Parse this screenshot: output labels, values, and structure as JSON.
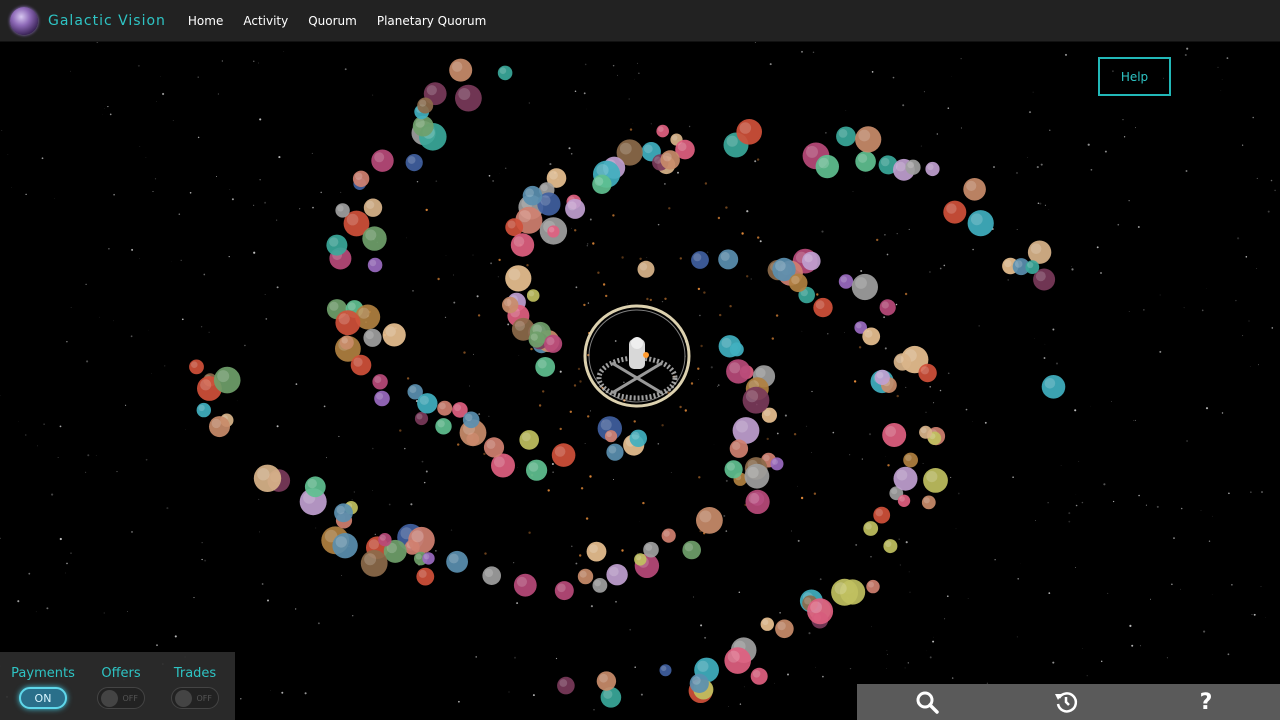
{
  "brand": {
    "name": "Galactic Vision",
    "logo_icon": "galaxy-logo-icon"
  },
  "nav": {
    "items": [
      "Home",
      "Activity",
      "Quorum",
      "Planetary Quorum"
    ]
  },
  "help_button": {
    "label": "Help"
  },
  "toggles": [
    {
      "label": "Payments",
      "state": "ON"
    },
    {
      "label": "Offers",
      "state": "OFF"
    },
    {
      "label": "Trades",
      "state": "OFF"
    }
  ],
  "toolbar": {
    "buttons": [
      {
        "icon": "search-icon"
      },
      {
        "icon": "history-icon"
      },
      {
        "icon": "question-icon",
        "label": "?"
      }
    ]
  },
  "colors": {
    "accent": "#2ec4c4",
    "navbar_bg": "#222222",
    "toolbar_bg": "#5a5a5a",
    "space_bg": "#000000"
  }
}
